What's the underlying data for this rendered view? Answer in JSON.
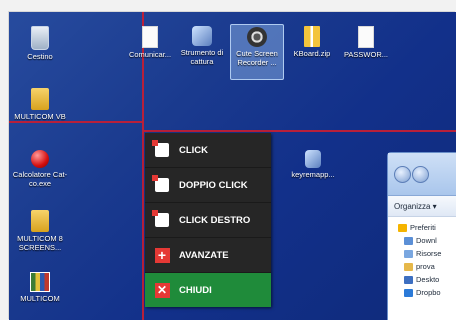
{
  "desktop": {
    "icons": [
      {
        "id": "cestino",
        "label": "Cestino"
      },
      {
        "id": "multicom-vb",
        "label": "MULTICOM VB"
      },
      {
        "id": "calcolatore",
        "label": "Calcolatore Cat-co.exe"
      },
      {
        "id": "multicom-8",
        "label": "MULTICOM 8 SCREENS..."
      },
      {
        "id": "multicom",
        "label": "MULTICOM"
      },
      {
        "id": "comunicar",
        "label": "Comunicar..."
      },
      {
        "id": "strumento",
        "label": "Strumento di cattura"
      },
      {
        "id": "cute",
        "label": "Cute Screen Recorder ..."
      },
      {
        "id": "kboard",
        "label": "KBoard.zip"
      },
      {
        "id": "passwor",
        "label": "PASSWOR..."
      },
      {
        "id": "keyremapp",
        "label": "keyremapp..."
      }
    ]
  },
  "context_menu": {
    "items": [
      {
        "label": "CLICK",
        "icon": "single-click-icon"
      },
      {
        "label": "DOPPIO CLICK",
        "icon": "double-click-icon"
      },
      {
        "label": "CLICK DESTRO",
        "icon": "right-click-icon"
      },
      {
        "label": "AVANZATE",
        "icon": "plus-icon"
      },
      {
        "label": "CHIUDI",
        "icon": "close-icon"
      }
    ]
  },
  "explorer": {
    "toolbar_label": "Organizza ▾",
    "nav_items": [
      "Preferiti",
      "Downl",
      "Risorse",
      "prova",
      "Deskto",
      "Dropbo"
    ]
  },
  "colors": {
    "gridline": "#b8203a",
    "menu_bg": "#262626",
    "menu_close_bg": "#1f8b3a",
    "accent_red": "#e53935"
  }
}
